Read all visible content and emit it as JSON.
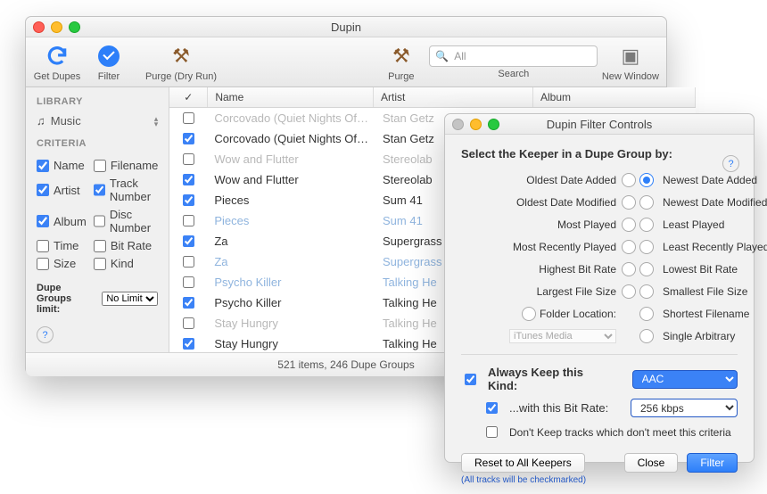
{
  "main_window": {
    "title": "Dupin",
    "toolbar": {
      "get_dupes": "Get Dupes",
      "filter": "Filter",
      "purge": "Purge (Dry Run)",
      "purge2": "Purge",
      "search_label": "Search",
      "search_placeholder": "All",
      "new_window": "New Window"
    },
    "sidebar": {
      "library_heading": "LIBRARY",
      "library_item": "Music",
      "criteria_heading": "CRITERIA",
      "criteria": [
        {
          "label": "Name",
          "checked": true
        },
        {
          "label": "Filename",
          "checked": false
        },
        {
          "label": "Artist",
          "checked": true
        },
        {
          "label": "Track Number",
          "checked": true
        },
        {
          "label": "Album",
          "checked": true
        },
        {
          "label": "Disc Number",
          "checked": false
        },
        {
          "label": "Time",
          "checked": false
        },
        {
          "label": "Bit Rate",
          "checked": false
        },
        {
          "label": "Size",
          "checked": false
        },
        {
          "label": "Kind",
          "checked": false
        }
      ],
      "dupe_limit_label": "Dupe Groups limit:",
      "dupe_limit_value": "No Limit"
    },
    "table": {
      "headers": {
        "check": "✓",
        "name": "Name",
        "artist": "Artist",
        "album": "Album"
      },
      "rows": [
        {
          "checked": false,
          "style": "dim",
          "name": "Corcovado (Quiet Nights Of…",
          "artist": "Stan Getz"
        },
        {
          "checked": true,
          "style": "",
          "name": "Corcovado (Quiet Nights Of…",
          "artist": "Stan Getz"
        },
        {
          "checked": false,
          "style": "dim",
          "name": "Wow and Flutter",
          "artist": "Stereolab"
        },
        {
          "checked": true,
          "style": "",
          "name": "Wow and Flutter",
          "artist": "Stereolab"
        },
        {
          "checked": true,
          "style": "",
          "name": "Pieces",
          "artist": "Sum 41"
        },
        {
          "checked": false,
          "style": "dimblue",
          "name": "Pieces",
          "artist": "Sum 41"
        },
        {
          "checked": true,
          "style": "",
          "name": "Za",
          "artist": "Supergrass"
        },
        {
          "checked": false,
          "style": "dimblue",
          "name": "Za",
          "artist": "Supergrass"
        },
        {
          "checked": false,
          "style": "dimblue",
          "name": "Psycho Killer",
          "artist": "Talking He"
        },
        {
          "checked": true,
          "style": "",
          "name": "Psycho Killer",
          "artist": "Talking He"
        },
        {
          "checked": false,
          "style": "dim",
          "name": "Stay Hungry",
          "artist": "Talking He"
        },
        {
          "checked": true,
          "style": "",
          "name": "Stay Hungry",
          "artist": "Talking He"
        }
      ]
    },
    "footer": "521 items, 246 Dupe Groups"
  },
  "filter_window": {
    "title": "Dupin Filter Controls",
    "heading": "Select the Keeper in a Dupe Group by:",
    "pairs": [
      {
        "left": "Oldest Date Added",
        "right": "Newest Date Added",
        "selected": "right"
      },
      {
        "left": "Oldest Date Modified",
        "right": "Newest Date Modified",
        "selected": "none"
      },
      {
        "left": "Most Played",
        "right": "Least Played",
        "selected": "none"
      },
      {
        "left": "Most Recently Played",
        "right": "Least Recently Played",
        "selected": "none"
      },
      {
        "left": "Highest Bit Rate",
        "right": "Lowest Bit Rate",
        "selected": "none"
      },
      {
        "left": "Largest File Size",
        "right": "Smallest File Size",
        "selected": "none"
      }
    ],
    "folder_label": "Folder Location:",
    "folder_value": "iTunes Media",
    "shortest_filename": "Shortest Filename",
    "single_arbitrary": "Single Arbitrary",
    "always_keep_label": "Always Keep this Kind:",
    "always_keep_value": "AAC",
    "bitrate_label": "...with this Bit Rate:",
    "bitrate_value": "256 kbps",
    "dont_keep_label": "Don't Keep tracks which don't meet this criteria",
    "reset_btn": "Reset to All Keepers",
    "close_btn": "Close",
    "filter_btn": "Filter",
    "note": "(All tracks will be checkmarked)"
  }
}
